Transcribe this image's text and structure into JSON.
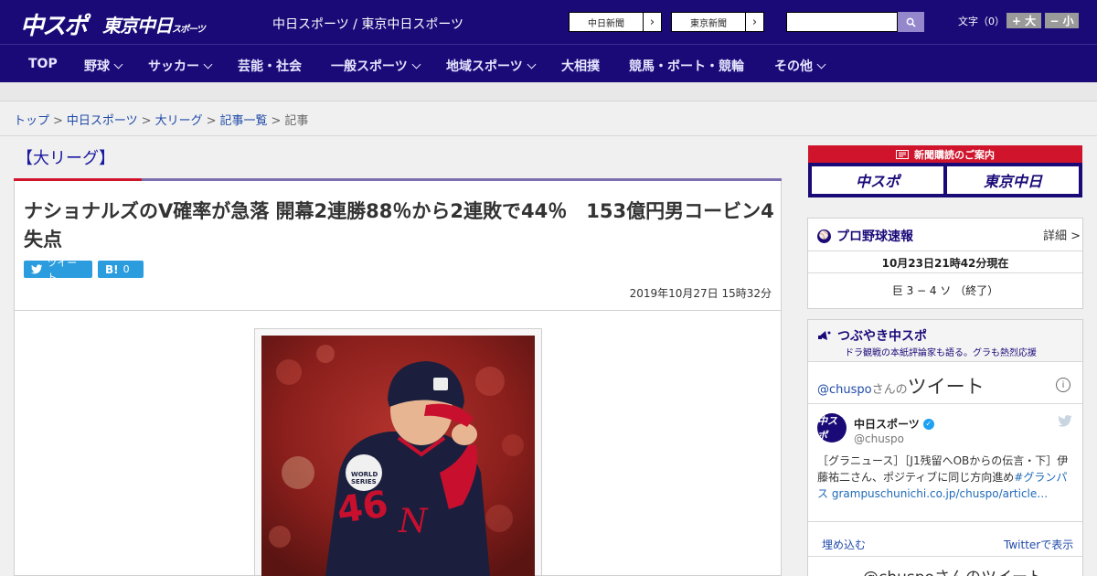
{
  "header": {
    "logo_chuspo": "中スポ",
    "logo_tokyo": "東京中日",
    "logo_tokyo_small": "スポーツ",
    "site_name": "中日スポーツ / 東京中日スポーツ",
    "paper_links": [
      "中日新聞",
      "東京新聞"
    ],
    "search_placeholder": "",
    "font_size_label": "文字（0）",
    "font_increase": "+ 大",
    "font_decrease": "− 小"
  },
  "nav": {
    "items": [
      {
        "label": "TOP",
        "dropdown": false
      },
      {
        "label": "野球",
        "dropdown": true
      },
      {
        "label": "サッカー",
        "dropdown": true
      },
      {
        "label": "芸能・社会",
        "dropdown": false
      },
      {
        "label": "一般スポーツ",
        "dropdown": true
      },
      {
        "label": "地域スポーツ",
        "dropdown": true
      },
      {
        "label": "大相撲",
        "dropdown": false
      },
      {
        "label": "競馬・ボート・競輪",
        "dropdown": false
      },
      {
        "label": "その他",
        "dropdown": true
      }
    ]
  },
  "breadcrumb": {
    "items": [
      "トップ",
      "中日スポーツ",
      "大リーグ",
      "記事一覧"
    ],
    "current": "記事",
    "separator": ">"
  },
  "article": {
    "category": "【大リーグ】",
    "headline": "ナショナルズのV確率が急落 開幕2連勝88％から2連敗で44％　153億円男コービン4失点",
    "tweet_label": "ツイート",
    "hatena_label": "B!",
    "hatena_count": "0",
    "date": "2019年10月27日 15時32分"
  },
  "sidebar": {
    "subscription_head": "新聞購読のご案内",
    "subscription_logos": [
      "中スポ",
      "東京中日"
    ],
    "baseball": {
      "title": "プロ野球速報",
      "detail": "詳細 >",
      "timestamp": "10月23日21時42分現在",
      "score": "巨 3 − 4 ソ （終了）"
    },
    "tsubuyaki": {
      "title": "つぶやき中スポ",
      "subtitle": "ドラ観戦の本紙評論家も語る。グラも熱烈応援"
    },
    "twitter": {
      "handle_prefix": "@chuspo",
      "handle_suffix": "さんの",
      "heading": "ツイート",
      "account_name": "中日スポーツ",
      "username": "@chuspo",
      "avatar_text": "中スポ",
      "tweet_text": "［グラニュース］［J1残留へOBからの伝言・下］伊藤祐二さん、ポジティブに同じ方向進め",
      "tweet_hashtag": "#グランパス",
      "tweet_link": "grampuschunichi.co.jp/chuspo/article…",
      "embed_label": "埋め込む",
      "view_label": "Twitterで表示",
      "next_heading": "@chuspoさんのツイート"
    }
  },
  "colors": {
    "brand_navy": "#1a0a78",
    "accent_red": "#d0142c",
    "share_blue": "#2b9ddf"
  }
}
